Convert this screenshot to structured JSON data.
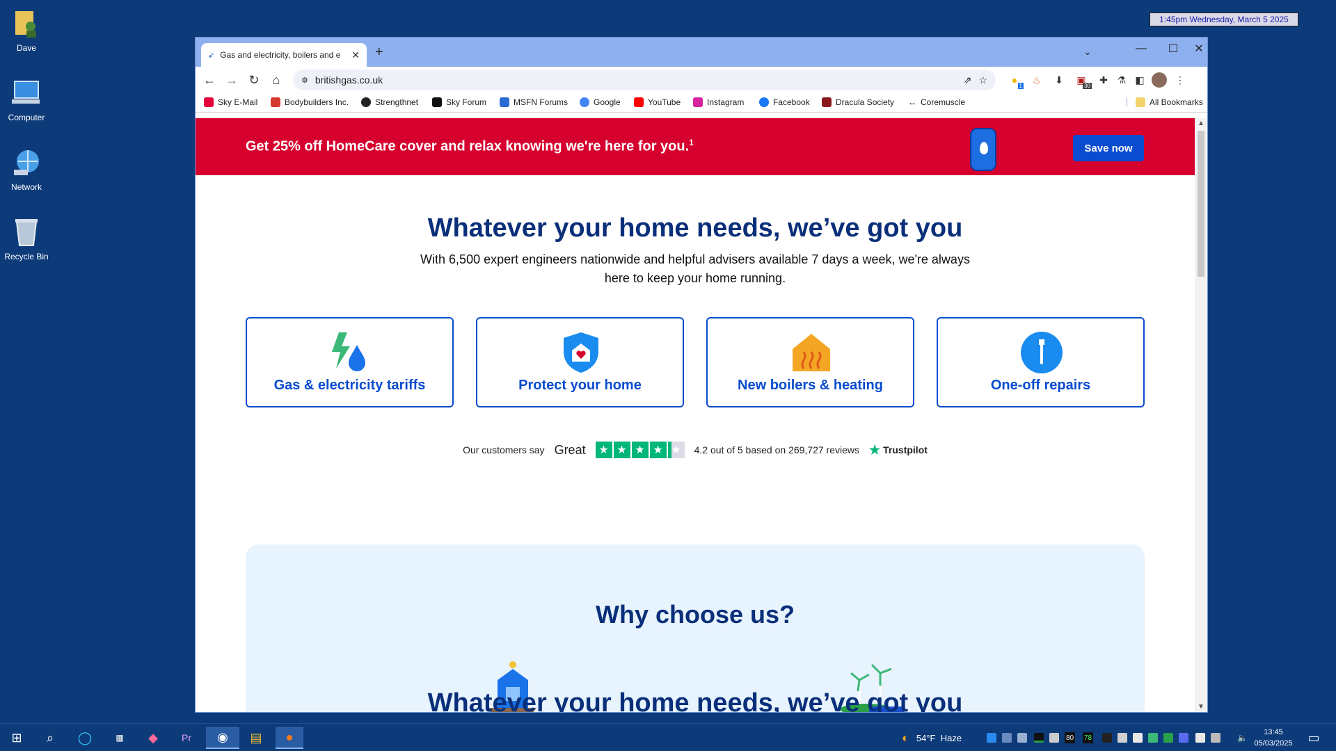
{
  "desktop": {
    "icons": [
      {
        "label": "Dave"
      },
      {
        "label": "Computer"
      },
      {
        "label": "Network"
      },
      {
        "label": "Recycle Bin"
      }
    ],
    "clock_widget": "1:45pm Wednesday, March 5 2025"
  },
  "browser": {
    "tab_title": "Gas and electricity, boilers and e",
    "url": "britishgas.co.uk",
    "bookmarks": [
      {
        "label": "Sky E-Mail",
        "color": "#e4003b"
      },
      {
        "label": "Bodybuilders Inc.",
        "color": "#d63b2f"
      },
      {
        "label": "Strengthnet",
        "color": "#222222"
      },
      {
        "label": "Sky Forum",
        "color": "#111111"
      },
      {
        "label": "MSFN Forums",
        "color": "#2a6bd3"
      },
      {
        "label": "Google",
        "color": "#4285f4"
      },
      {
        "label": "YouTube",
        "color": "#ff0000"
      },
      {
        "label": "Instagram",
        "color": "#d6249f"
      },
      {
        "label": "Facebook",
        "color": "#1877f2"
      },
      {
        "label": "Dracula Society",
        "color": "#8a1a1a"
      },
      {
        "label": "Coremuscle",
        "color": "#333333"
      }
    ],
    "all_bookmarks": "All Bookmarks",
    "ext_badges": {
      "first": "1",
      "second": "30"
    }
  },
  "page": {
    "promo": {
      "text": "Get 25% off HomeCare cover and relax knowing we're here for you.",
      "sup": "1",
      "button": "Save now"
    },
    "hero": {
      "title": "Whatever your home needs, we’ve got you",
      "subtitle": "With 6,500 expert engineers nationwide and helpful advisers available 7 days a week, we're always here to keep your home running."
    },
    "cards": [
      {
        "label": "Gas & electricity tariffs"
      },
      {
        "label": "Protect your home"
      },
      {
        "label": "New boilers & heating"
      },
      {
        "label": "One-off repairs"
      }
    ],
    "trustpilot": {
      "prefix": "Our customers say",
      "rating_word": "Great",
      "summary": "4.2 out of 5 based on 269,727 reviews",
      "brand": "Trustpilot",
      "rating": 4.2
    },
    "why_title": "Why choose us?",
    "ghost_text": "Whatever your home needs, we’ve got you"
  },
  "taskbar": {
    "weather": "54°F  Haze",
    "tray_numbers": {
      "a": "80",
      "b": "78"
    },
    "time": "13:45",
    "date": "05/03/2025"
  }
}
